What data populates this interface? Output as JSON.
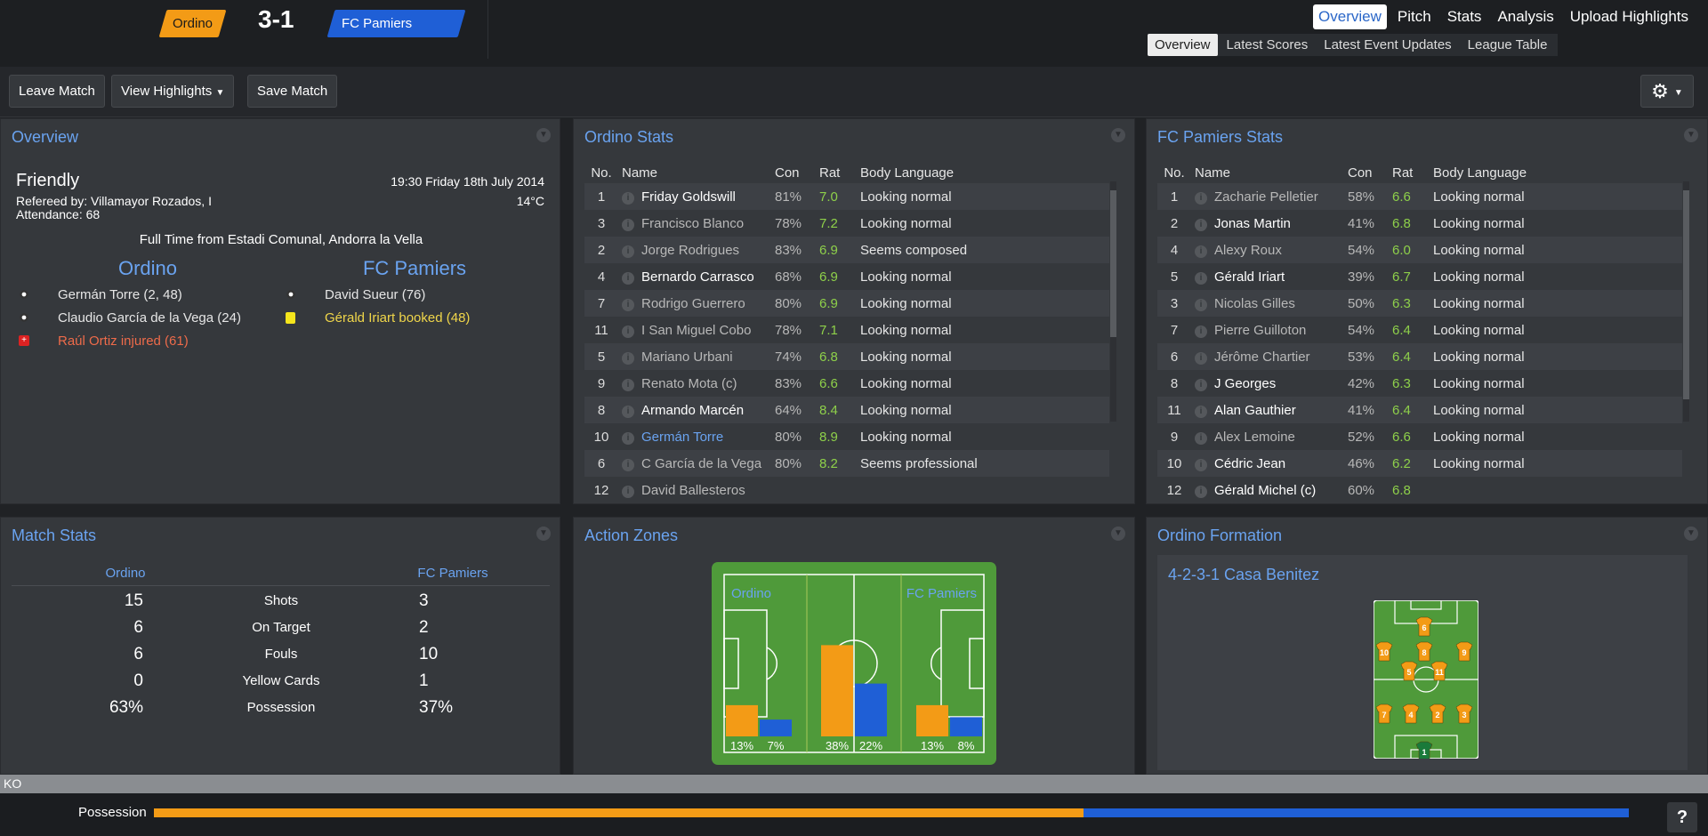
{
  "match": {
    "home": "Ordino",
    "away": "FC Pamiers",
    "score": "3-1"
  },
  "nav": {
    "main": [
      "Overview",
      "Pitch",
      "Stats",
      "Analysis",
      "Upload Highlights"
    ],
    "sub": [
      "Overview",
      "Latest Scores",
      "Latest Event Updates",
      "League Table"
    ]
  },
  "toolbar": {
    "leave": "Leave Match",
    "highlights": "View Highlights",
    "save": "Save Match"
  },
  "overview": {
    "title": "Overview",
    "type": "Friendly",
    "datetime": "19:30 Friday 18th July 2014",
    "referee": "Refereed by: Villamayor Rozados, I",
    "temp": "14°C",
    "attendance": "Attendance: 68",
    "status": "Full Time from Estadi Comunal, Andorra la Vella",
    "home_events": [
      {
        "icon": "ball-icon",
        "text": "Germán Torre (2, 48)",
        "color": "#e6e6e6"
      },
      {
        "icon": "ball-icon",
        "text": "Claudio García de la Vega (24)",
        "color": "#e6e6e6"
      },
      {
        "icon": "injury-icon",
        "text": "Raúl Ortiz injured (61)",
        "color": "#ee6b4a"
      }
    ],
    "away_events": [
      {
        "icon": "ball-icon",
        "text": "David Sueur (76)",
        "color": "#e6e6e6"
      },
      {
        "icon": "yellow-card-icon",
        "text": "Gérald Iriart booked (48)",
        "color": "#f0d64a"
      }
    ]
  },
  "stats_headers": [
    "No.",
    "Name",
    "Con",
    "Rat",
    "Body Language"
  ],
  "home_stats": {
    "title": "Ordino Stats",
    "rows": [
      {
        "no": "1",
        "name": "Friday Goldswill",
        "con": "81%",
        "rat": "7.0",
        "bl": "Looking normal",
        "style": "b",
        "cc": "y"
      },
      {
        "no": "3",
        "name": "Francisco Blanco",
        "con": "78%",
        "rat": "7.2",
        "bl": "Looking normal",
        "style": "",
        "cc": "y"
      },
      {
        "no": "2",
        "name": "Jorge Rodrigues",
        "con": "83%",
        "rat": "6.9",
        "bl": "Seems composed",
        "style": "",
        "cc": "y"
      },
      {
        "no": "4",
        "name": "Bernardo Carrasco",
        "con": "68%",
        "rat": "6.9",
        "bl": "Looking normal",
        "style": "b",
        "cc": "y"
      },
      {
        "no": "7",
        "name": "Rodrigo Guerrero",
        "con": "80%",
        "rat": "6.9",
        "bl": "Looking normal",
        "style": "",
        "cc": "y"
      },
      {
        "no": "11",
        "name": "I San Miguel Cobo",
        "con": "78%",
        "rat": "7.1",
        "bl": "Looking normal",
        "style": "",
        "cc": "y"
      },
      {
        "no": "5",
        "name": "Mariano Urbani",
        "con": "74%",
        "rat": "6.8",
        "bl": "Looking normal",
        "style": "",
        "cc": "y"
      },
      {
        "no": "9",
        "name": "Renato Mota (c)",
        "con": "83%",
        "rat": "6.6",
        "bl": "Looking normal",
        "style": "",
        "cc": "y"
      },
      {
        "no": "8",
        "name": "Armando Marcén",
        "con": "64%",
        "rat": "8.4",
        "bl": "Looking normal",
        "style": "b",
        "cc": "y"
      },
      {
        "no": "10",
        "name": "Germán Torre",
        "con": "80%",
        "rat": "8.9",
        "bl": "Looking normal",
        "style": "hl",
        "cc": "y"
      },
      {
        "no": "6",
        "name": "C García de la Vega",
        "con": "80%",
        "rat": "8.2",
        "bl": "Seems professional",
        "style": "",
        "cc": "y"
      },
      {
        "no": "12",
        "name": "David Ballesteros",
        "con": "",
        "rat": "",
        "bl": "",
        "style": "",
        "cc": "y"
      }
    ]
  },
  "away_stats": {
    "title": "FC Pamiers Stats",
    "rows": [
      {
        "no": "1",
        "name": "Zacharie Pelletier",
        "con": "58%",
        "rat": "6.6",
        "bl": "Looking normal",
        "style": "",
        "cc": "r"
      },
      {
        "no": "2",
        "name": "Jonas Martin",
        "con": "41%",
        "rat": "6.8",
        "bl": "Looking normal",
        "style": "b",
        "cc": "r"
      },
      {
        "no": "4",
        "name": "Alexy Roux",
        "con": "54%",
        "rat": "6.0",
        "bl": "Looking normal",
        "style": "",
        "cc": "r"
      },
      {
        "no": "5",
        "name": "Gérald Iriart",
        "con": "39%",
        "rat": "6.7",
        "bl": "Looking normal",
        "style": "b",
        "cc": "r"
      },
      {
        "no": "3",
        "name": "Nicolas Gilles",
        "con": "50%",
        "rat": "6.3",
        "bl": "Looking normal",
        "style": "",
        "cc": "r"
      },
      {
        "no": "7",
        "name": "Pierre Guilloton",
        "con": "54%",
        "rat": "6.4",
        "bl": "Looking normal",
        "style": "",
        "cc": "r"
      },
      {
        "no": "6",
        "name": "Jérôme Chartier",
        "con": "53%",
        "rat": "6.4",
        "bl": "Looking normal",
        "style": "",
        "cc": "r"
      },
      {
        "no": "8",
        "name": "J Georges",
        "con": "42%",
        "rat": "6.3",
        "bl": "Looking normal",
        "style": "b",
        "cc": "r"
      },
      {
        "no": "11",
        "name": "Alan Gauthier",
        "con": "41%",
        "rat": "6.4",
        "bl": "Looking normal",
        "style": "b",
        "cc": "r"
      },
      {
        "no": "9",
        "name": "Alex Lemoine",
        "con": "52%",
        "rat": "6.6",
        "bl": "Looking normal",
        "style": "",
        "cc": "r"
      },
      {
        "no": "10",
        "name": "Cédric Jean",
        "con": "46%",
        "rat": "6.2",
        "bl": "Looking normal",
        "style": "b",
        "cc": "r"
      },
      {
        "no": "12",
        "name": "Gérald Michel (c)",
        "con": "60%",
        "rat": "6.8",
        "bl": "",
        "style": "b",
        "cc": "y"
      }
    ]
  },
  "match_stats": {
    "title": "Match Stats",
    "home": "Ordino",
    "away": "FC Pamiers",
    "rows": [
      {
        "label": "Shots",
        "home": "15",
        "away": "3"
      },
      {
        "label": "On Target",
        "home": "6",
        "away": "2"
      },
      {
        "label": "Fouls",
        "home": "6",
        "away": "10"
      },
      {
        "label": "Yellow Cards",
        "home": "0",
        "away": "1"
      },
      {
        "label": "Possession",
        "home": "63%",
        "away": "37%"
      }
    ]
  },
  "action_zones": {
    "title": "Action Zones",
    "home": "Ordino",
    "away": "FC Pamiers",
    "zones": [
      {
        "home": 13,
        "away": 7
      },
      {
        "home": 38,
        "away": 22
      },
      {
        "home": 13,
        "away": 8
      }
    ],
    "colors": {
      "home": "#f39b16",
      "away": "#1f5fd6"
    }
  },
  "formation": {
    "title": "Ordino Formation",
    "name": "4-2-3-1 Casa Benitez",
    "players": [
      "6",
      "10",
      "8",
      "9",
      "5",
      "11",
      "7",
      "4",
      "2",
      "3",
      "1"
    ]
  },
  "footer": {
    "ko": "KO",
    "possession_label": "Possession",
    "possession_home": 0.63
  }
}
